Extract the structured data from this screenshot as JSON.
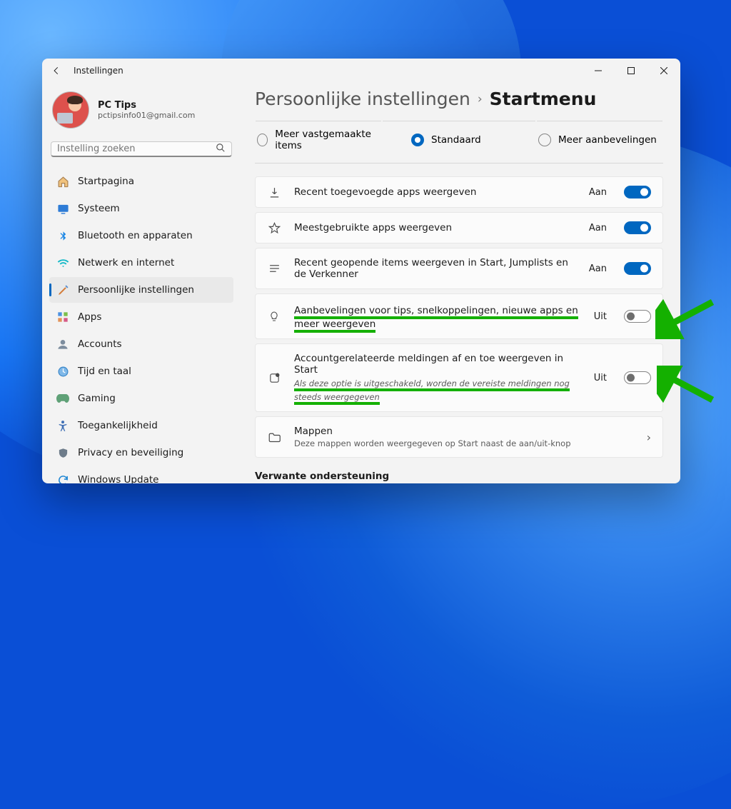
{
  "window": {
    "title": "Instellingen"
  },
  "profile": {
    "name": "PC Tips",
    "email": "pctipsinfo01@gmail.com"
  },
  "search": {
    "placeholder": "Instelling zoeken"
  },
  "sidebar": {
    "items": [
      {
        "label": "Startpagina"
      },
      {
        "label": "Systeem"
      },
      {
        "label": "Bluetooth en apparaten"
      },
      {
        "label": "Netwerk en internet"
      },
      {
        "label": "Persoonlijke instellingen"
      },
      {
        "label": "Apps"
      },
      {
        "label": "Accounts"
      },
      {
        "label": "Tijd en taal"
      },
      {
        "label": "Gaming"
      },
      {
        "label": "Toegankelijkheid"
      },
      {
        "label": "Privacy en beveiliging"
      },
      {
        "label": "Windows Update"
      }
    ]
  },
  "breadcrumb": {
    "parent": "Persoonlijke instellingen",
    "current": "Startmenu"
  },
  "radios": {
    "opt1": "Meer vastgemaakte items",
    "opt2": "Standaard",
    "opt3": "Meer aanbevelingen"
  },
  "settings": {
    "recent_apps": {
      "title": "Recent toegevoegde apps weergeven",
      "state": "Aan"
    },
    "most_used": {
      "title": "Meestgebruikte apps weergeven",
      "state": "Aan"
    },
    "recent_items": {
      "title": "Recent geopende items weergeven in Start, Jumplists en de Verkenner",
      "state": "Aan"
    },
    "recommendations": {
      "title": "Aanbevelingen voor tips, snelkoppelingen, nieuwe apps en meer weergeven",
      "state": "Uit"
    },
    "account_notif": {
      "title": "Accountgerelateerde meldingen af en toe weergeven in Start",
      "sub": "Als deze optie is uitgeschakeld, worden de vereiste meldingen nog steeds weergegeven",
      "state": "Uit"
    },
    "folders": {
      "title": "Mappen",
      "sub": "Deze mappen worden weergegeven op Start naast de aan/uit-knop"
    }
  },
  "related_support": "Verwante ondersteuning"
}
